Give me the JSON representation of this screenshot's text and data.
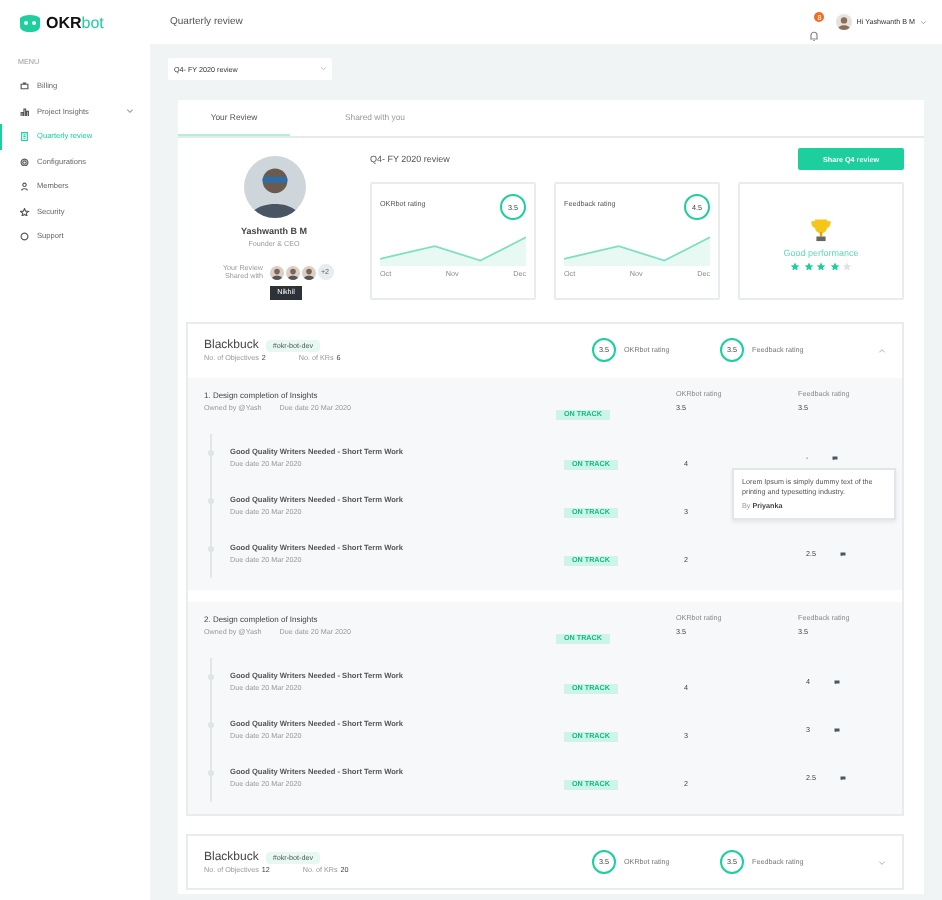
{
  "sidebar": {
    "logo": {
      "brand": "OKR",
      "suffix": "bot"
    },
    "menu_label": "MENU",
    "items": [
      {
        "label": "Billing",
        "kind": "link",
        "selected": false
      },
      {
        "label": "Project Insights",
        "kind": "group",
        "selected": false
      },
      {
        "label": "Quarterly review",
        "kind": "link",
        "selected": true
      },
      {
        "label": "Configurations",
        "kind": "link",
        "selected": false
      },
      {
        "label": "Members",
        "kind": "link",
        "selected": false
      },
      {
        "label": "Security",
        "kind": "link",
        "selected": false
      },
      {
        "label": "Support",
        "kind": "link",
        "selected": false
      }
    ]
  },
  "header": {
    "title": "Quarterly review",
    "notifications": "8",
    "user": "Hi Yashwanth B M"
  },
  "period_select": {
    "value": "Q4- FY 2020 review"
  },
  "tabs": [
    {
      "label": "Your Review",
      "selected": true
    },
    {
      "label": "Shared with you",
      "selected": false
    }
  ],
  "profile": {
    "name": "Yashwanth B M",
    "role": "Founder & CEO",
    "shared_label": "Your Review Shared with",
    "more": "+2",
    "tooltip": "Nikhil"
  },
  "review": {
    "title": "Q4- FY 2020 review",
    "share_button": "Share Q4 review",
    "ratings": [
      {
        "title": "OKRbot rating",
        "score": "3.5",
        "months": [
          "Oct",
          "Nov",
          "Dec"
        ]
      },
      {
        "title": "Feedback rating",
        "score": "4.5",
        "months": [
          "Oct",
          "Nov",
          "Dec"
        ]
      }
    ],
    "performance": {
      "label": "Good performance",
      "stars": 4
    }
  },
  "projects": [
    {
      "name": "Blackbuck",
      "tag": "#okr-bot-dev",
      "objectives_label": "No. of Objectives",
      "objectives_count": "2",
      "krs_label": "No. of KRs",
      "krs_count": "6",
      "okrbot_score": "3.5",
      "okrbot_label": "OKRbot rating",
      "feedback_score": "3.5",
      "feedback_label": "Feedback rating",
      "expanded": true,
      "objectives": [
        {
          "title": "1. Design completion of Insights",
          "owner": "Owned by @Yash",
          "due": "Due date 20 Mar  2020",
          "status": "ON TRACK",
          "okrbot_label": "OKRbot rating",
          "okrbot": "3.5",
          "feedback_label": "Feedback rating",
          "feedback": "3.5",
          "key_results": [
            {
              "title": "Good Quality Writers Needed - Short Term Work",
              "due": "Due date 20 Mar  2020",
              "status": "ON TRACK",
              "okrbot": "4",
              "feedback": "-",
              "comment": {
                "text": "Lorem Ipsum is simply dummy text of the printing and typesetting industry.",
                "by_label": "By",
                "author": "Priyanka"
              }
            },
            {
              "title": "Good Quality Writers Needed - Short Term Work",
              "due": "Due date 20 Mar  2020",
              "status": "ON TRACK",
              "okrbot": "3"
            },
            {
              "title": "Good Quality Writers Needed - Short Term Work",
              "due": "Due date 20 Mar  2020",
              "status": "ON TRACK",
              "okrbot": "2",
              "feedback": "2.5"
            }
          ]
        },
        {
          "title": "2. Design completion of Insights",
          "owner": "Owned by @Yash",
          "due": "Due date 20 Mar  2020",
          "status": "ON TRACK",
          "okrbot_label": "OKRbot rating",
          "okrbot": "3.5",
          "feedback_label": "Feedback rating",
          "feedback": "3.5",
          "key_results": [
            {
              "title": "Good Quality Writers Needed - Short Term Work",
              "due": "Due date 20 Mar  2020",
              "status": "ON TRACK",
              "okrbot": "4",
              "feedback": "4"
            },
            {
              "title": "Good Quality Writers Needed - Short Term Work",
              "due": "Due date 20 Mar  2020",
              "status": "ON TRACK",
              "okrbot": "3",
              "feedback": "3"
            },
            {
              "title": "Good Quality Writers Needed - Short Term Work",
              "due": "Due date 20 Mar  2020",
              "status": "ON TRACK",
              "okrbot": "2",
              "feedback": "2.5"
            }
          ]
        }
      ]
    },
    {
      "name": "Blackbuck",
      "tag": "#okr-bot-dev",
      "objectives_label": "No. of Objectives",
      "objectives_count": "12",
      "krs_label": "No. of KRs",
      "krs_count": "20",
      "okrbot_score": "3.5",
      "okrbot_label": "OKRbot rating",
      "feedback_score": "3.5",
      "feedback_label": "Feedback rating",
      "expanded": false
    }
  ]
}
